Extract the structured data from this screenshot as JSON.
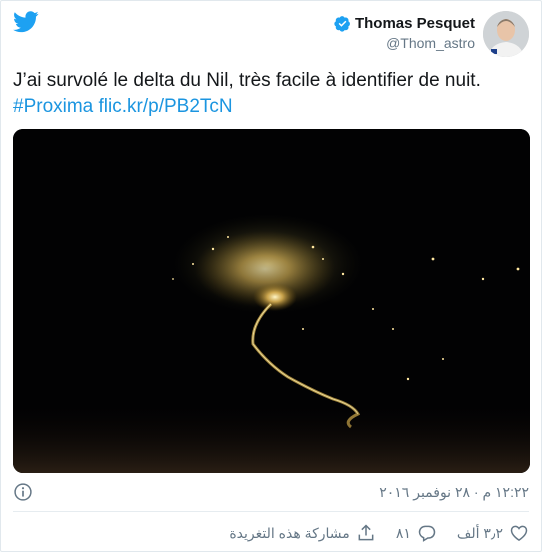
{
  "author": {
    "display_name": "Thomas Pesquet",
    "handle": "@Thom_astro"
  },
  "tweet": {
    "text_line1": "J’ai survolé le delta du Nil, très facile à identifier de nuit.",
    "hashtag": "#Proxima",
    "link": "flic.kr/p/PB2TcN"
  },
  "meta": {
    "timestamp": "١٢:٢٢ م · ٢٨ نوفمبر ٢٠١٦"
  },
  "actions": {
    "like_count": "٣٫٢ ألف",
    "reply_count": "٨١",
    "share_label": "مشاركة هذه التغريدة"
  },
  "colors": {
    "brand": "#1da1f2",
    "link": "#1b95e0",
    "muted": "#657786"
  },
  "icons": [
    "twitter-logo-icon",
    "verified-badge-icon",
    "info-icon",
    "heart-icon",
    "reply-icon",
    "share-icon"
  ]
}
